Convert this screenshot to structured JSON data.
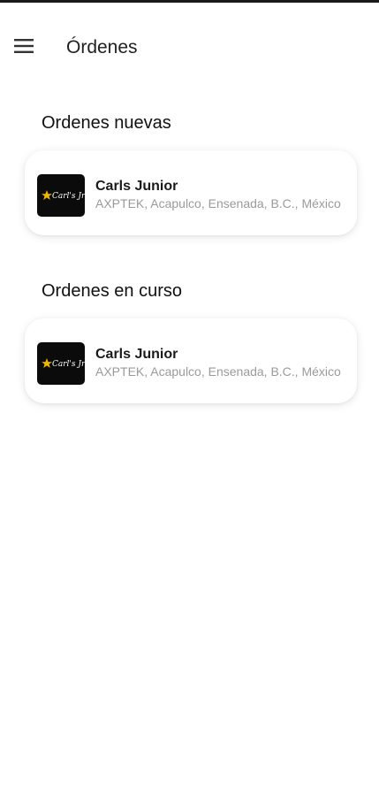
{
  "app_bar": {
    "title": "Órdenes",
    "menu_icon": "hamburger-menu-icon"
  },
  "sections": [
    {
      "title": "Ordenes nuevas",
      "orders": [
        {
          "name": "Carls Junior",
          "address": "AXPTEK, Acapulco, Ensenada, B.C., México",
          "logo_text": "Carl's Jr.",
          "logo_icon": "star-icon"
        }
      ]
    },
    {
      "title": "Ordenes en curso",
      "orders": [
        {
          "name": "Carls Junior",
          "address": "AXPTEK, Acapulco, Ensenada, B.C., México",
          "logo_text": "Carl's Jr.",
          "logo_icon": "star-icon"
        }
      ]
    }
  ],
  "colors": {
    "background": "#ffffff",
    "logo_background": "#0b0b0b",
    "logo_star": "#f2b705",
    "address_text": "#9a9a9a"
  }
}
